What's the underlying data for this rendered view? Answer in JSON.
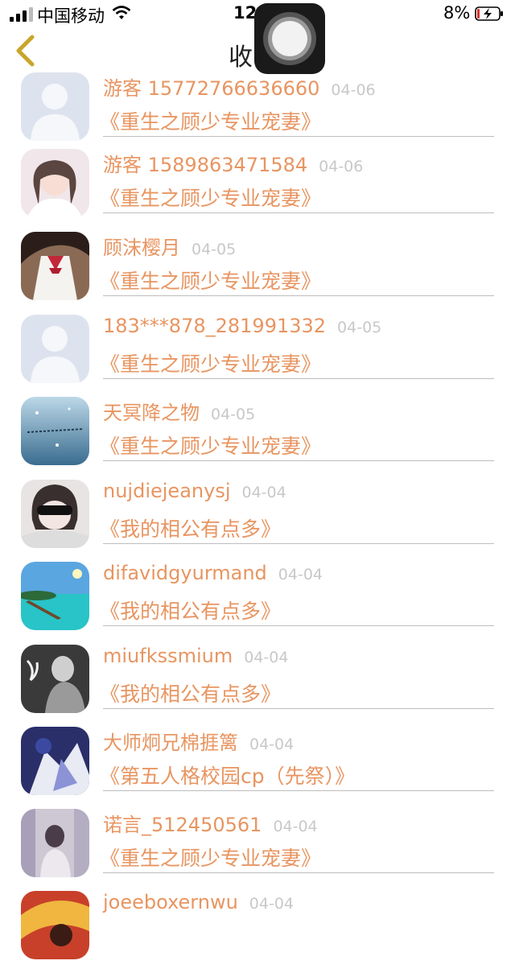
{
  "status_bar": {
    "carrier": "中国移动",
    "time": "12",
    "battery_percent": "8%"
  },
  "nav": {
    "title": "收"
  },
  "comments": [
    {
      "name": "游客 15772766636660",
      "date": "04-06",
      "book": "《重生之顾少专业宠妻》",
      "avatar": "placeholder"
    },
    {
      "name": "游客 1589863471584",
      "date": "04-06",
      "book": "《重生之顾少专业宠妻》",
      "avatar": "girl"
    },
    {
      "name": "顾沫樱月",
      "date": "04-05",
      "book": "《重生之顾少专业宠妻》",
      "avatar": "schoolgirl"
    },
    {
      "name": "183***878_281991332",
      "date": "04-05",
      "book": "《重生之顾少专业宠妻》",
      "avatar": "placeholder"
    },
    {
      "name": "天冥降之物",
      "date": "04-05",
      "book": "《重生之顾少专业宠妻》",
      "avatar": "rain"
    },
    {
      "name": "nujdiejeanysj",
      "date": "04-04",
      "book": "《我的相公有点多》",
      "avatar": "sunglasses"
    },
    {
      "name": "difavidgyurmand",
      "date": "04-04",
      "book": "《我的相公有点多》",
      "avatar": "beach"
    },
    {
      "name": "miufkssmium",
      "date": "04-04",
      "book": "《我的相公有点多》",
      "avatar": "dark"
    },
    {
      "name": "大师炯兄棉捱篱",
      "date": "04-04",
      "book": "《第五人格校园cp（先祭）》",
      "avatar": "anime"
    },
    {
      "name": "诺言_512450561",
      "date": "04-04",
      "book": "《重生之顾少专业宠妻》",
      "avatar": "bookstore"
    },
    {
      "name": "joeeboxernwu",
      "date": "04-04",
      "book": "",
      "avatar": "colorful"
    }
  ],
  "colors": {
    "accent": "#e89561",
    "date": "#c8c8c8",
    "divider": "#bdbdbd",
    "back_arrow": "#c9a52a"
  }
}
